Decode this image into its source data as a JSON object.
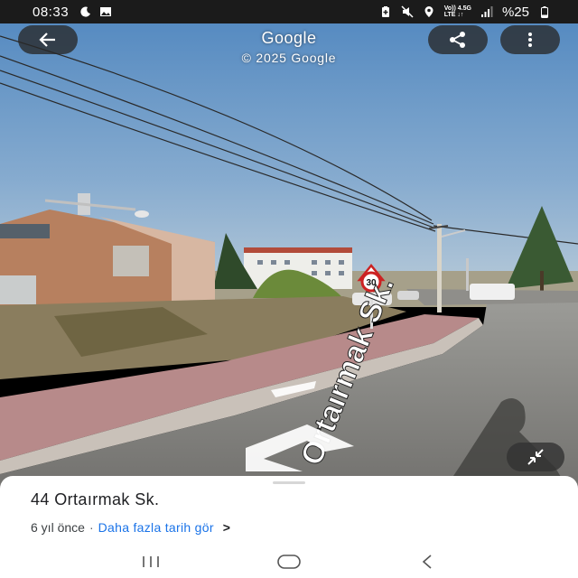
{
  "status_bar": {
    "time": "08:33",
    "left_icons": [
      "moon-icon",
      "image-icon"
    ],
    "right_icons": [
      "battery-saver-icon",
      "mute-icon",
      "location-icon",
      "network-icon",
      "signal-icon",
      "battery-icon"
    ],
    "network_line1": "Vo)) 4.5G",
    "network_line2": "LTE ↓↑",
    "battery": "%25"
  },
  "header": {
    "title": "Google",
    "subtitle": "© 2025 Google"
  },
  "scene": {
    "street_label": "Ortaırmak Sk.",
    "speed_limit": "30"
  },
  "bottom_sheet": {
    "place_title": "44 Ortaırmak Sk.",
    "date_text": "6 yıl önce",
    "separator": "·",
    "history_link": "Daha fazla tarih gör",
    "chevron": ">"
  },
  "colors": {
    "link": "#1a73e8",
    "status_bar": "#1b1b1b",
    "sky": "#5a8ec2"
  }
}
